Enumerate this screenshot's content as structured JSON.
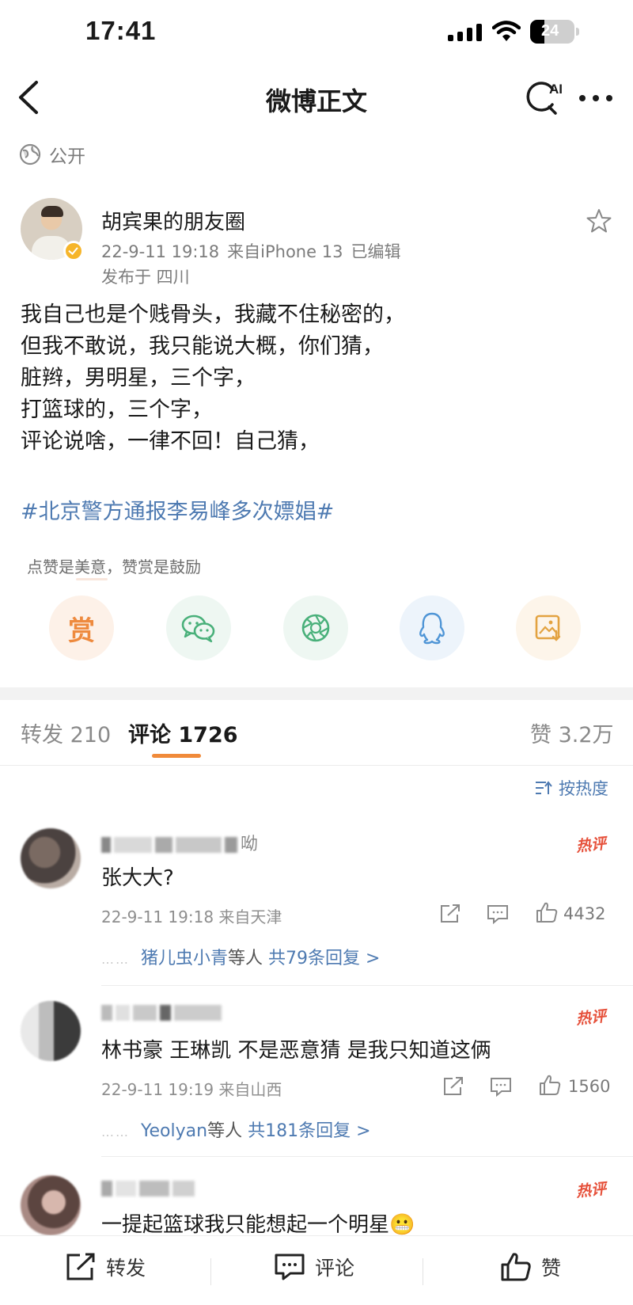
{
  "status_bar": {
    "time": "17:41",
    "battery": "24"
  },
  "nav": {
    "title": "微博正文",
    "ai_label": "AI"
  },
  "visibility": {
    "label": "公开"
  },
  "author": {
    "name": "胡宾果的朋友圈",
    "date": "22-9-11 19:18",
    "source": "来自iPhone 13",
    "edited": "已编辑",
    "location": "发布于 四川"
  },
  "post": {
    "lines": [
      "我自己也是个贱骨头，我藏不住秘密的，",
      "但我不敢说，我只能说大概，你们猜，",
      "脏辫，男明星，三个字，",
      "打篮球的，三个字，",
      "评论说啥，一律不回！自己猜，"
    ],
    "hashtag": "#北京警方通报李易峰多次嫖娼#",
    "reward_hint": "点赞是美意，赞赏是鼓励",
    "reward_label": "赏"
  },
  "tabs": {
    "repost": "转发 210",
    "comment": "评论 1726",
    "like": "赞 3.2万"
  },
  "sort": {
    "label": "按热度"
  },
  "comments": [
    {
      "name_tail": "呦",
      "text": "张大大?",
      "date": "22-9-11 19:18",
      "location": "来自天津",
      "likes": "4432",
      "hot": "热评",
      "reply_users": "猪儿虫小青",
      "reply_mid": "等人",
      "reply_count": "共79条回复 >"
    },
    {
      "name_tail": "",
      "text": "林书豪 王琳凯 不是恶意猜 是我只知道这俩",
      "date": "22-9-11 19:19",
      "location": "来自山西",
      "likes": "1560",
      "hot": "热评",
      "reply_users": "Yeolyan",
      "reply_mid": "等人",
      "reply_count": "共181条回复 >"
    },
    {
      "name_tail": "",
      "text": "一提起篮球我只能想起一个明星",
      "emoji": "😬",
      "hot": "热评"
    }
  ],
  "bottom_bar": {
    "repost": "转发",
    "comment": "评论",
    "like": "赞"
  },
  "colors": {
    "link": "#4e7ab1",
    "accent": "#f08a3a",
    "hot": "#e6513b"
  }
}
